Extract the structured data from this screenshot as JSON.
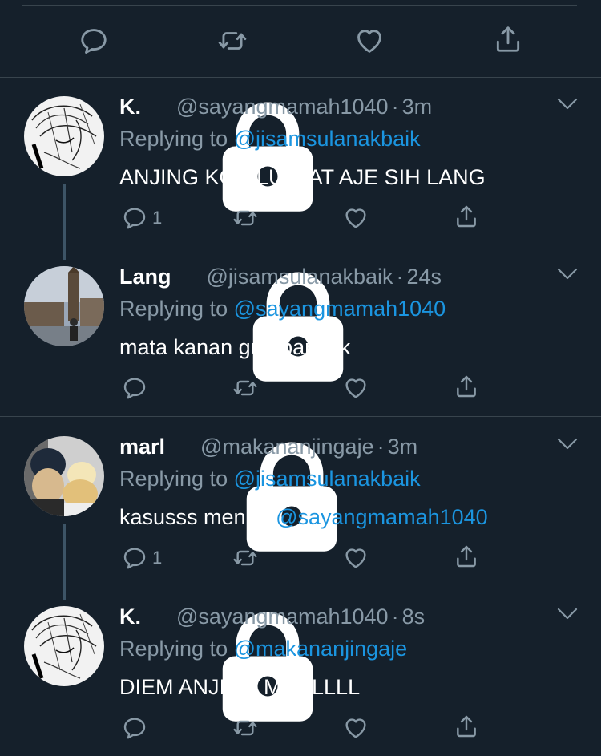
{
  "colors": {
    "background": "#15202b",
    "divider": "#38444d",
    "secondary_text": "#8899a6",
    "link": "#1b95e0",
    "icon": "#8899a6"
  },
  "top_actions": {
    "icons": [
      "reply-icon",
      "retweet-icon",
      "like-icon",
      "share-icon"
    ]
  },
  "tweets": [
    {
      "name": "K.",
      "handle": "@sayangmamah1040",
      "separator": "·",
      "time": "3m",
      "reply_prefix": "Replying to",
      "reply_to": "@jisamsulanakbaik",
      "text": "ANJING KOK LU LIAT AJE SIH LANG",
      "text_mention": "",
      "reply_count": "1"
    },
    {
      "name": "Lang",
      "handle": "@jisamsulanakbaik",
      "separator": "·",
      "time": "24s",
      "reply_prefix": "Replying to",
      "reply_to": "@sayangmamah1040",
      "text": "mata kanan gua banyak",
      "text_mention": "",
      "reply_count": ""
    },
    {
      "name": "marl",
      "handle": "@makananjingaje",
      "separator": "·",
      "time": "3m",
      "reply_prefix": "Replying to",
      "reply_to": "@jisamsulanakbaik",
      "text": "kasusss mennn ",
      "text_mention": "@sayangmamah1040",
      "reply_count": "1"
    },
    {
      "name": "K.",
      "handle": "@sayangmamah1040",
      "separator": "·",
      "time": "8s",
      "reply_prefix": "Replying to",
      "reply_to": "@makananjingaje",
      "text": "DIEM ANJING MARLLLL",
      "text_mention": "",
      "reply_count": ""
    }
  ]
}
